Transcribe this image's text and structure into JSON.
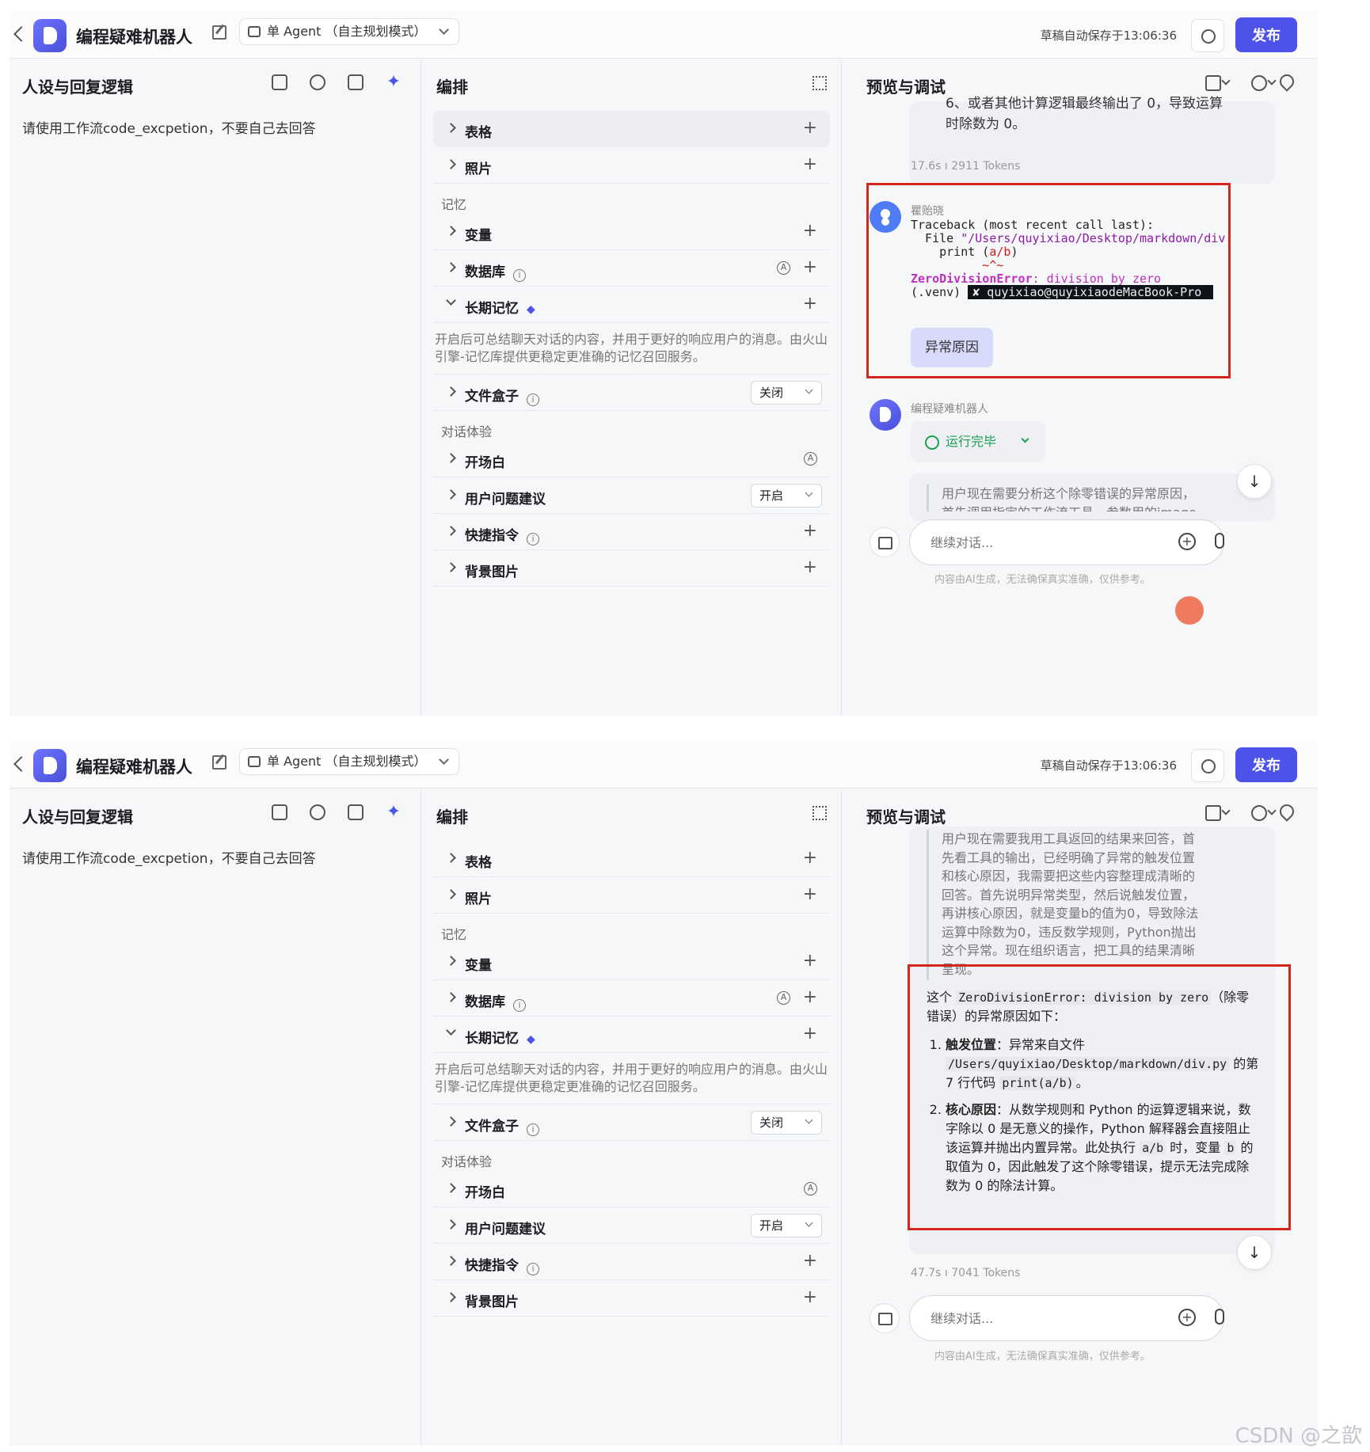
{
  "header": {
    "bot_name": "编程疑难机器人",
    "agent_mode": "单 Agent （自主规划模式）",
    "autosave": "草稿自动保存于13:06:36",
    "publish_label": "发布"
  },
  "left": {
    "title": "人设与回复逻辑",
    "persona_text": "请使用工作流code_excpetion，不要自己去回答",
    "icons": [
      "skill-icon",
      "bulb-icon",
      "template-icon",
      "sparkle-icon"
    ]
  },
  "mid": {
    "title": "编排",
    "table_label": "表格",
    "photo_label": "照片",
    "memory_group": "记忆",
    "variable_label": "变量",
    "database_label": "数据库",
    "longterm_label": "长期记忆",
    "longterm_desc": "开启后可总结聊天对话的内容，并用于更好的响应用户的消息。由火山引擎-记忆库提供更稳定更准确的记忆召回服务。",
    "filebox_label": "文件盒子",
    "filebox_value": "关闭",
    "dialog_group": "对话体验",
    "opening_label": "开场白",
    "suggest_label": "用户问题建议",
    "suggest_value": "开启",
    "shortcut_label": "快捷指令",
    "background_label": "背景图片",
    "plus": "+",
    "badge_auto": "A",
    "info_glyph": "i"
  },
  "right": {
    "title": "预览与调试",
    "input_placeholder": "继续对话...",
    "disclaimer": "内容由AI生成，无法确保真实准确，仅供参考。",
    "scroll_glyph": "↓"
  },
  "shot1": {
    "prev_reply_tail_line1": "6、或者其他计算逻辑最终输出了 0，导致运算",
    "prev_reply_tail_line2": "时除数为 0。",
    "prev_meta": "17.6s  ı  2911 Tokens",
    "user_name": "瞿贻晓",
    "code_line1": "Traceback (most recent call last):",
    "code_line2_prefix": "  File ",
    "code_line2_path": "\"/Users/quyixiao/Desktop/markdown/div.",
    "code_line3_prefix": "    print (",
    "code_line3_expr": "a/b",
    "code_line3_suffix": ")",
    "code_line4_marks": "          ~^~",
    "code_line5_name": "ZeroDivisionError",
    "code_line5_msg": ": division by zero",
    "code_line6_env": "(.venv) ",
    "code_line6_term": "✘ quyixiao@quyixiaodeMacBook-Pro ",
    "chip_label": "异常原因",
    "bot_label": "编程疑难机器人",
    "status": "运行完毕",
    "think_line1": "用户现在需要分析这个除零错误的异常原因，",
    "think_line2": "首先调用指定的工作流工具，参数用的image..."
  },
  "shot2": {
    "think_lines": [
      "用户现在需要我用工具返回的结果来回答，首",
      "先看工具的输出，已经明确了异常的触发位置",
      "和核心原因，我需要把这些内容整理成清晰的",
      "回答。首先说明异常类型，然后说触发位置，",
      "再讲核心原因，就是变量b的值为0，导致除法",
      "运算中除数为0，违反数学规则，Python抛出",
      "这个异常。现在组织语言，把工具的结果清晰",
      "呈现。"
    ],
    "answer_intro_pre": "这个 ",
    "answer_intro_code": "ZeroDivisionError: division by zero",
    "answer_intro_post": "（除零错误）的异常原因如下：",
    "item1_title": "触发位置",
    "item1_pre": "：异常来自文件 ",
    "item1_path": "/Users/quyixiao/Desktop/markdown/div.py",
    "item1_mid": " 的第 7 行代码 ",
    "item1_code": "print(a/b)",
    "item1_post": "。",
    "item2_title": "核心原因",
    "item2_pre": "：从数学规则和 Python 的运算逻辑来说，数字除以 0 是无意义的操作，Python 解释器会直接阻止该运算并抛出内置异常。此处执行 ",
    "item2_code1": "a/b",
    "item2_mid": " 时，变量 ",
    "item2_code2": "b",
    "item2_post": " 的取值为 0，因此触发了这个除零错误，提示无法完成除数为 0 的除法计算。",
    "meta": "47.7s  ı  7041 Tokens"
  },
  "watermark": "CSDN @之歆",
  "colors": {
    "accent": "#4d53e8",
    "highlight_box": "#d2261e",
    "success": "#1f9d55"
  }
}
